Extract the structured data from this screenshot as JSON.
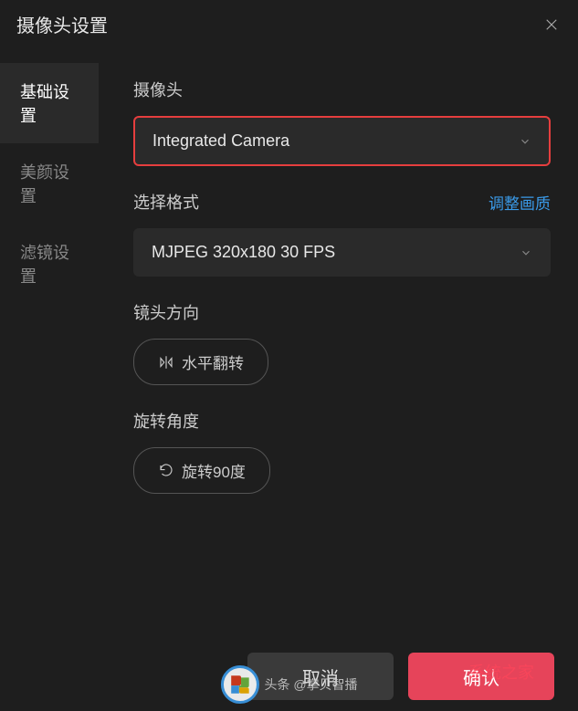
{
  "window": {
    "title": "摄像头设置"
  },
  "sidebar": {
    "items": [
      {
        "label": "基础设置",
        "active": true
      },
      {
        "label": "美颜设置",
        "active": false
      },
      {
        "label": "滤镜设置",
        "active": false
      }
    ]
  },
  "content": {
    "camera": {
      "label": "摄像头",
      "value": "Integrated Camera"
    },
    "format": {
      "label": "选择格式",
      "link": "调整画质",
      "value": "MJPEG 320x180 30 FPS"
    },
    "direction": {
      "label": "镜头方向",
      "button": "水平翻转"
    },
    "rotation": {
      "label": "旋转角度",
      "button": "旋转90度"
    }
  },
  "footer": {
    "cancel": "取消",
    "confirm": "确认"
  },
  "watermark": {
    "center_text": "头条 @掌贝智播",
    "right_text": "系统之家"
  }
}
